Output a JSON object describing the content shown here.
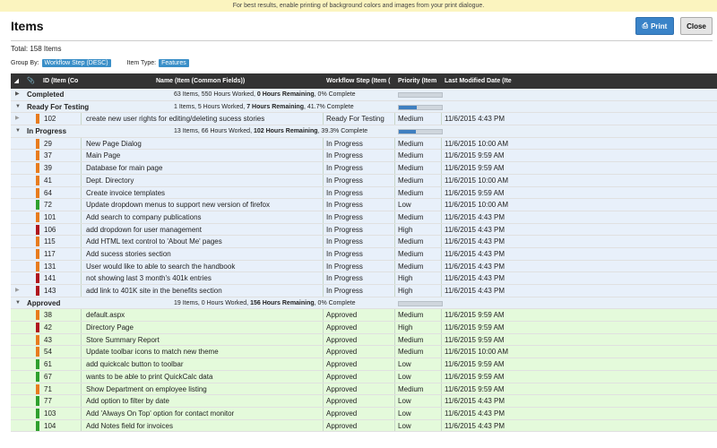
{
  "notice": "For best results, enable printing of background colors and images from your print dialogue.",
  "title": "Items",
  "buttons": {
    "print": "Print",
    "close": "Close"
  },
  "total": "Total: 158 Items",
  "group_by_label": "Group By:",
  "group_by_value": "Workflow Step (DESC)",
  "item_type_label": "Item Type:",
  "item_type_value": "Features",
  "columns": [
    "ID (Item (Co",
    "Name (Item (Common Fields))",
    "Workflow Step (Item (",
    "Priority (Item",
    "Last Modified Date (Ite"
  ],
  "colors": {
    "blue_row": "#e8f0fa",
    "green_row": "#e4fadb",
    "orange": "#e87c1e",
    "red": "#b0161e",
    "green": "#2ea02e"
  },
  "groups": [
    {
      "name": "Completed",
      "summary_pre": "63 Items, 550 Hours Worked, ",
      "summary_bold": "0 Hours Remaining",
      "summary_post": ", 0% Complete",
      "progress": 0,
      "rows": []
    },
    {
      "name": "Ready For Testing",
      "summary_pre": "1 Items, 5 Hours Worked, ",
      "summary_bold": "7 Hours Remaining",
      "summary_post": ", 41.7% Complete",
      "progress": 41.7,
      "rows": [
        {
          "id": "102",
          "name": "create new user rights for editing/deleting sucess stories",
          "step": "Ready For Testing",
          "priority": "Medium",
          "date": "11/6/2015 4:43 PM",
          "color": "orange",
          "arrow": true
        }
      ]
    },
    {
      "name": "In Progress",
      "summary_pre": "13 Items, 66 Hours Worked, ",
      "summary_bold": "102 Hours Remaining",
      "summary_post": ", 39.3% Complete",
      "progress": 39.3,
      "rows": [
        {
          "id": "29",
          "name": "New Page Dialog",
          "step": "In Progress",
          "priority": "Medium",
          "date": "11/6/2015 10:00 AM",
          "color": "orange"
        },
        {
          "id": "37",
          "name": "Main Page",
          "step": "In Progress",
          "priority": "Medium",
          "date": "11/6/2015 9:59 AM",
          "color": "orange"
        },
        {
          "id": "39",
          "name": "Database for main page",
          "step": "In Progress",
          "priority": "Medium",
          "date": "11/6/2015 9:59 AM",
          "color": "orange"
        },
        {
          "id": "41",
          "name": "Dept. Directory",
          "step": "In Progress",
          "priority": "Medium",
          "date": "11/6/2015 10:00 AM",
          "color": "orange"
        },
        {
          "id": "64",
          "name": "Create invoice templates",
          "step": "In Progress",
          "priority": "Medium",
          "date": "11/6/2015 9:59 AM",
          "color": "orange"
        },
        {
          "id": "72",
          "name": "Update dropdown menus to support new version of firefox",
          "step": "In Progress",
          "priority": "Low",
          "date": "11/6/2015 10:00 AM",
          "color": "green"
        },
        {
          "id": "101",
          "name": "Add search to company publications",
          "step": "In Progress",
          "priority": "Medium",
          "date": "11/6/2015 4:43 PM",
          "color": "orange"
        },
        {
          "id": "106",
          "name": "add dropdown for user management",
          "step": "In Progress",
          "priority": "High",
          "date": "11/6/2015 4:43 PM",
          "color": "red"
        },
        {
          "id": "115",
          "name": "Add HTML text control to 'About Me' pages",
          "step": "In Progress",
          "priority": "Medium",
          "date": "11/6/2015 4:43 PM",
          "color": "orange"
        },
        {
          "id": "117",
          "name": "Add sucess stories section",
          "step": "In Progress",
          "priority": "Medium",
          "date": "11/6/2015 4:43 PM",
          "color": "orange"
        },
        {
          "id": "131",
          "name": "User would like to able to search the handbook",
          "step": "In Progress",
          "priority": "Medium",
          "date": "11/6/2015 4:43 PM",
          "color": "orange"
        },
        {
          "id": "141",
          "name": "not showing last 3 month's 401k entries",
          "step": "In Progress",
          "priority": "High",
          "date": "11/6/2015 4:43 PM",
          "color": "red"
        },
        {
          "id": "143",
          "name": "add link to 401K site in the benefits section",
          "step": "In Progress",
          "priority": "High",
          "date": "11/6/2015 4:43 PM",
          "color": "red",
          "arrow": true
        }
      ]
    },
    {
      "name": "Approved",
      "summary_pre": "19 Items, 0 Hours Worked, ",
      "summary_bold": "156 Hours Remaining",
      "summary_post": ", 0% Complete",
      "progress": 0,
      "rows": [
        {
          "id": "38",
          "name": "default.aspx",
          "step": "Approved",
          "priority": "Medium",
          "date": "11/6/2015 9:59 AM",
          "color": "orange"
        },
        {
          "id": "42",
          "name": "Directory Page",
          "step": "Approved",
          "priority": "High",
          "date": "11/6/2015 9:59 AM",
          "color": "red"
        },
        {
          "id": "43",
          "name": "Store Summary Report",
          "step": "Approved",
          "priority": "Medium",
          "date": "11/6/2015 9:59 AM",
          "color": "orange"
        },
        {
          "id": "54",
          "name": "Update toolbar icons to match new theme",
          "step": "Approved",
          "priority": "Medium",
          "date": "11/6/2015 10:00 AM",
          "color": "orange"
        },
        {
          "id": "61",
          "name": "add quickcalc button to toolbar",
          "step": "Approved",
          "priority": "Low",
          "date": "11/6/2015 9:59 AM",
          "color": "green"
        },
        {
          "id": "67",
          "name": "wants to be able to print QuickCalc data",
          "step": "Approved",
          "priority": "Low",
          "date": "11/6/2015 9:59 AM",
          "color": "green"
        },
        {
          "id": "71",
          "name": "Show Department on employee listing",
          "step": "Approved",
          "priority": "Medium",
          "date": "11/6/2015 9:59 AM",
          "color": "orange"
        },
        {
          "id": "77",
          "name": "Add option to filter by date",
          "step": "Approved",
          "priority": "Low",
          "date": "11/6/2015 4:43 PM",
          "color": "green"
        },
        {
          "id": "103",
          "name": "Add 'Always On Top' option for contact monitor",
          "step": "Approved",
          "priority": "Low",
          "date": "11/6/2015 4:43 PM",
          "color": "green"
        },
        {
          "id": "104",
          "name": "Add Notes field for invoices",
          "step": "Approved",
          "priority": "Low",
          "date": "11/6/2015 4:43 PM",
          "color": "green"
        }
      ]
    }
  ]
}
